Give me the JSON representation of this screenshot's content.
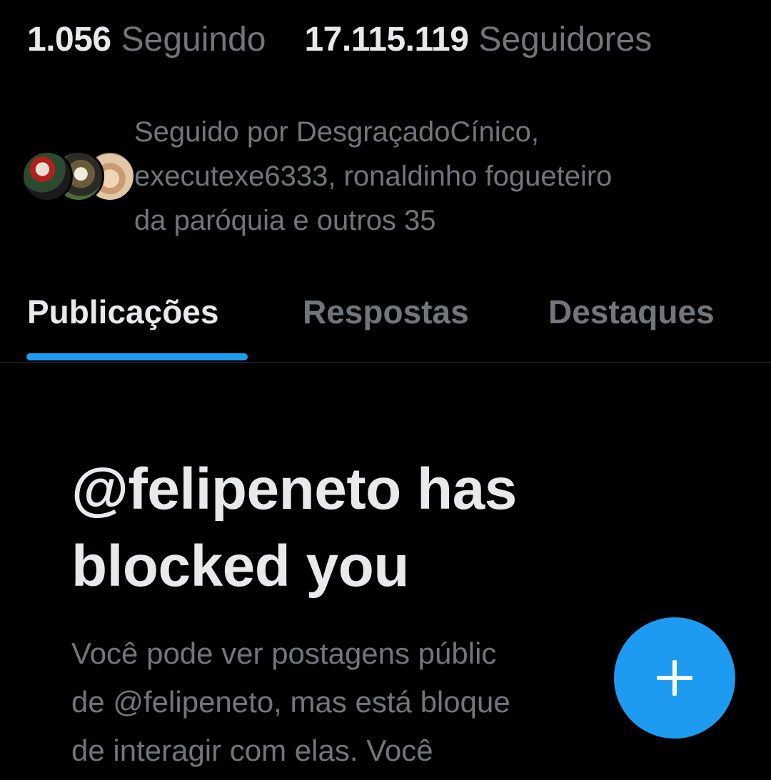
{
  "stats": {
    "following_count": "1.056",
    "following_label": "Seguindo",
    "followers_count": "17.115.119",
    "followers_label": "Seguidores"
  },
  "followed_by": {
    "line1": "Seguido por DesgraçadoCínico,",
    "line2": "executexe6333, ronaldinho fogueteiro",
    "line3": "da paróquia e outros 35"
  },
  "tabs": [
    {
      "label": "Publicações",
      "active": true
    },
    {
      "label": "Respostas",
      "active": false
    },
    {
      "label": "Destaques",
      "active": false
    }
  ],
  "blocked": {
    "title_line1": "@felipeneto has",
    "title_line2": "blocked you",
    "desc_line1": "Você pode ver postagens públic",
    "desc_line2": "de @felipeneto, mas está bloque",
    "desc_line3": "de interagir com elas. Você"
  },
  "fab": {
    "icon": "plus-icon"
  },
  "colors": {
    "background": "#000000",
    "text_primary": "#e7e9ea",
    "text_secondary": "#71767b",
    "accent": "#1d9bf0",
    "divider": "#2f3336"
  }
}
